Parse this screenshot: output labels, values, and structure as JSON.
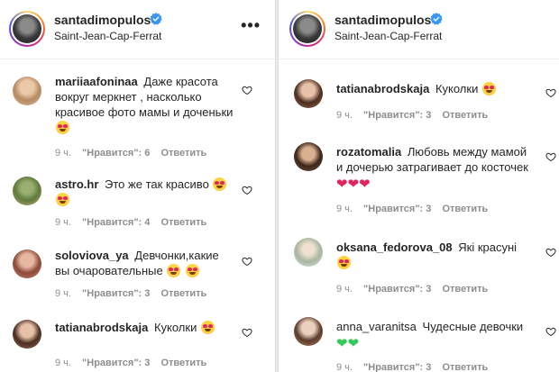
{
  "colors": {
    "text": "#262626",
    "secondary": "#8e8e8e",
    "verified_blue": "#3897f0",
    "red_heart": "#e0245e",
    "green_heart": "#34c759"
  },
  "icons": {
    "verified": "verified-badge-icon",
    "more": "more-horizontal-icon",
    "like": "heart-outline-icon",
    "emoji_heart_eyes": "heart-eyes-emoji",
    "emoji_red_heart": "red-heart-emoji",
    "emoji_green_heart": "green-heart-emoji"
  },
  "left": {
    "header": {
      "username": "santadimopulos",
      "location": "Saint-Jean-Cap-Ferrat",
      "more": "•••"
    },
    "comments": [
      {
        "username": "mariiaafoninaa",
        "text": "Даже красота вокруг меркнет , насколько красивое фото мамы и доченьки",
        "time": "9 ч.",
        "likes": "\"Нравится\": 6",
        "reply": "Ответить"
      },
      {
        "username": "astro.hr",
        "text": "Это же так красиво",
        "time": "9 ч.",
        "likes": "\"Нравится\": 4",
        "reply": "Ответить"
      },
      {
        "username": "soloviova_ya",
        "text": "Девчонки,какие вы очаровательные",
        "time": "9 ч.",
        "likes": "\"Нравится\": 3",
        "reply": "Ответить"
      },
      {
        "username": "tatianabrodskaja",
        "text": "Куколки",
        "time": "9 ч.",
        "likes": "\"Нравится\": 3",
        "reply": "Ответить"
      }
    ]
  },
  "right": {
    "header": {
      "username": "santadimopulos",
      "location": "Saint-Jean-Cap-Ferrat"
    },
    "comments": [
      {
        "username": "tatianabrodskaja",
        "text": "Куколки",
        "time": "9 ч.",
        "likes": "\"Нравится\": 3",
        "reply": "Ответить"
      },
      {
        "username": "rozatomalia",
        "text": "Любовь между мамой и дочерью затрагивает до косточек",
        "time": "9 ч.",
        "likes": "\"Нравится\": 3",
        "reply": "Ответить"
      },
      {
        "username": "oksana_fedorova_08",
        "text": "Які красуні",
        "time": "9 ч.",
        "likes": "\"Нравится\": 3",
        "reply": "Ответить"
      },
      {
        "username": "anna_varanitsa",
        "text": "Чудесные девочки",
        "time": "9 ч.",
        "likes": "\"Нравится\": 3",
        "reply": "Ответить"
      }
    ]
  }
}
